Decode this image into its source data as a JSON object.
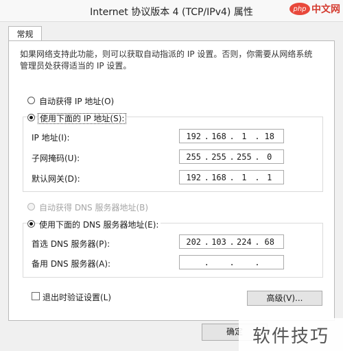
{
  "window": {
    "title": "Internet 协议版本 4 (TCP/IPv4) 属性"
  },
  "watermark_top": {
    "badge": "php",
    "text": "中文网"
  },
  "tabs": [
    {
      "label": "常规"
    }
  ],
  "description": "如果网络支持此功能，则可以获取自动指派的 IP 设置。否则，你需要从网络系统管理员处获得适当的 IP 设置。",
  "ip_section": {
    "auto_label": "自动获得 IP 地址(O)",
    "manual_label": "使用下面的 IP 地址(S):",
    "fields": [
      {
        "label": "IP 地址(I):",
        "segments": [
          "192",
          "168",
          "1",
          "18"
        ]
      },
      {
        "label": "子网掩码(U):",
        "segments": [
          "255",
          "255",
          "255",
          "0"
        ]
      },
      {
        "label": "默认网关(D):",
        "segments": [
          "192",
          "168",
          "1",
          "1"
        ]
      }
    ]
  },
  "dns_section": {
    "auto_label": "自动获得 DNS 服务器地址(B)",
    "manual_label": "使用下面的 DNS 服务器地址(E):",
    "fields": [
      {
        "label": "首选 DNS 服务器(P):",
        "segments": [
          "202",
          "103",
          "224",
          "68"
        ]
      },
      {
        "label": "备用 DNS 服务器(A):",
        "segments": [
          "",
          "",
          "",
          ""
        ]
      }
    ]
  },
  "validate_label": "退出时验证设置(L)",
  "advanced_button": "高级(V)...",
  "ok_button": "确定",
  "watermark_bottom": "软件技巧"
}
